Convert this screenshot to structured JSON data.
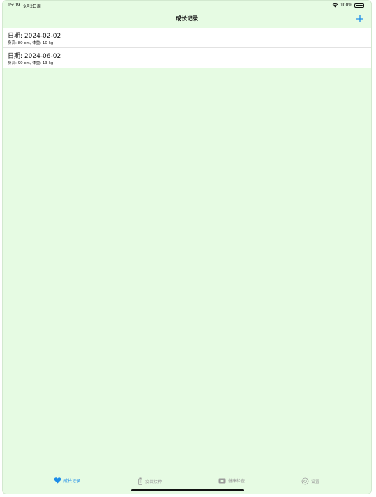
{
  "status_bar": {
    "time": "15:09",
    "date": "9月2日周一",
    "battery": "100%"
  },
  "nav": {
    "title": "成长记录",
    "add_icon": "plus-icon"
  },
  "records": [
    {
      "date": "日期: 2024-02-02",
      "detail": "身高: 80 cm, 体重: 10 kg"
    },
    {
      "date": "日期: 2024-06-02",
      "detail": "身高: 90 cm, 体重: 13 kg"
    }
  ],
  "tabs": [
    {
      "label": "成长记录",
      "icon": "heart-icon",
      "active": true
    },
    {
      "label": "疫苗接种",
      "icon": "vial-icon",
      "active": false
    },
    {
      "label": "健康检查",
      "icon": "camera-icon",
      "active": false
    },
    {
      "label": "设置",
      "icon": "gear-icon",
      "active": false
    }
  ],
  "colors": {
    "background": "#e6fbe3",
    "accent": "#1c8ce8",
    "inactive": "#9a9a9a"
  }
}
